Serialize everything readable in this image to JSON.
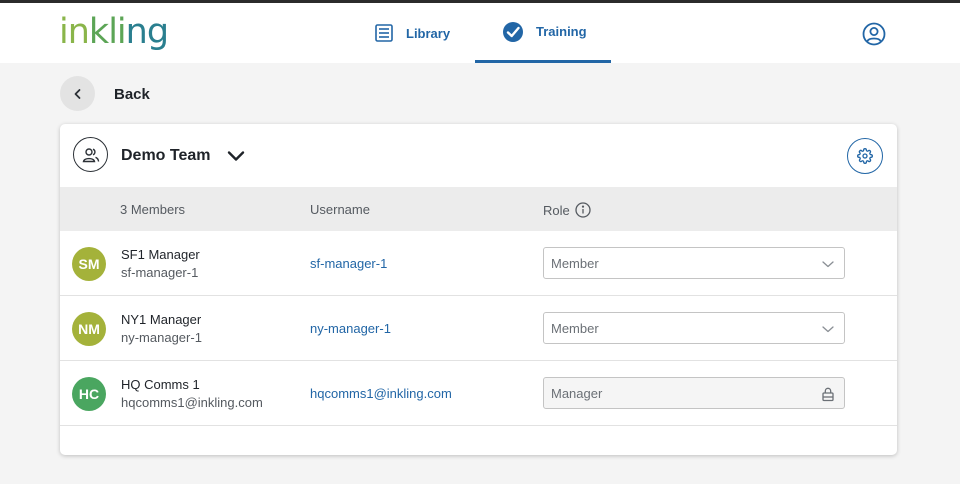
{
  "header": {
    "logo": {
      "p1": "in",
      "p2": "k",
      "p3": "li",
      "p4": "ng"
    },
    "tabs": [
      {
        "label": "Library"
      },
      {
        "label": "Training"
      }
    ]
  },
  "back": {
    "label": "Back"
  },
  "team": {
    "name": "Demo Team"
  },
  "table": {
    "headers": {
      "members": "3 Members",
      "username": "Username",
      "role": "Role"
    },
    "rows": [
      {
        "initials": "SM",
        "color": "#a4b23a",
        "name": "SF1 Manager",
        "sub": "sf-manager-1",
        "username": "sf-manager-1",
        "role": "Member"
      },
      {
        "initials": "NM",
        "color": "#a4b23a",
        "name": "NY1 Manager",
        "sub": "ny-manager-1",
        "username": "ny-manager-1",
        "role": "Member"
      },
      {
        "initials": "HC",
        "color": "#4aa660",
        "name": "HQ Comms 1",
        "sub": "hqcomms1@inkling.com",
        "username": "hqcomms1@inkling.com",
        "role": "Manager"
      }
    ]
  },
  "colors": {
    "accent": "#2266a6",
    "background": "#f4f4f4"
  }
}
